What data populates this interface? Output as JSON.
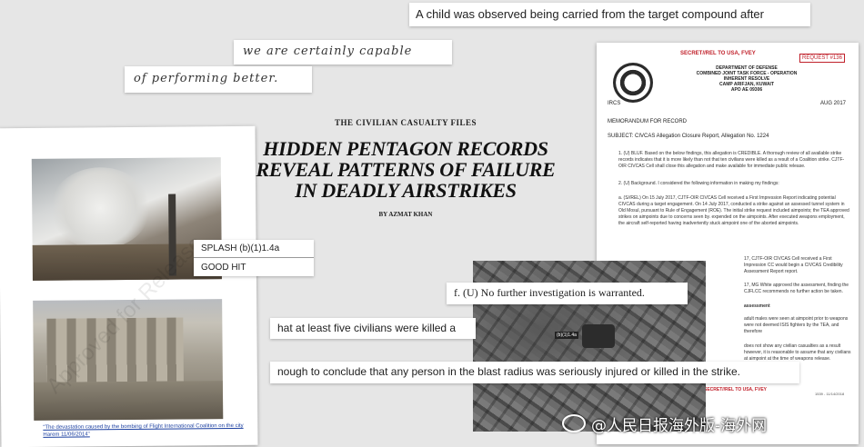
{
  "strips": {
    "top_right": "A child was observed being carried from the target compound after",
    "hand_1": "we are certainly capable",
    "hand_2": "of performing better.",
    "investigation": "f. (U) No further investigation is warranted.",
    "civilians": "hat at least five civilians were killed a",
    "blast": "nough to conclude that any person in the blast radius was seriously injured or killed in the strike."
  },
  "headline": {
    "kicker": "THE CIVILIAN CASUALTY FILES",
    "title_1": "HIDDEN PENTAGON RECORDS",
    "title_2": "REVEAL PATTERNS OF FAILURE",
    "title_3": "IN DEADLY AIRSTRIKES",
    "byline": "BY AZMAT KHAN"
  },
  "left_doc": {
    "label_1": "SPLASH (b)(1)1.4a",
    "label_2": "GOOD HIT",
    "caption": "\"The devastation caused by the bombing of Flight International Coalition on the city Harem 11/06/2014\""
  },
  "memo": {
    "classification": "SECRET//REL TO USA, FVEY",
    "request": "REQUEST #136",
    "dept_1": "DEPARTMENT OF DEFENSE",
    "dept_2": "COMBINED JOINT TASK FORCE - OPERATION INHERENT RESOLVE",
    "dept_3": "CAMP ARIFJAN, KUWAIT",
    "dept_4": "APO AE 09306",
    "ircs": "IRCS",
    "date": "AUG 2017",
    "memo_for": "MEMORANDUM FOR RECORD",
    "subject": "SUBJECT: CIVCAS Allegation Closure Report, Allegation No. 1224",
    "p1": "1. (U) BLUF. Based on the below findings, this allegation is CREDIBLE. A thorough review of all available strike records indicates that it is more likely than not that ten civilians were killed as a result of a Coalition strike. CJTF-OIR CIVCAS Cell shall close this allegation and make available for immediate public release.",
    "p2": "2. (U) Background. I considered the following information in making my findings:",
    "p3": "a. (S//REL) On 15 July 2017, CJTF-OIR CIVCAS Cell received a First Impression Report indicating potential CIVCAS during a target engagement. On 14 July 2017, conducted a strike against an assessed tunnel system in Old Mosul, pursuant to Rule of Engagement (ROE). The initial strike request included aimpoints; the TEA approved strikes on aimpoints due to concerns seen by. expended on the aimpoints. After executed weapons employment, the aircraft self-reported having inadvertently stuck aimpoint one of the aborted aimpoints.",
    "p4": "17, CJTF-OIR CIVCAS Cell received a First Impression CC would begin a CIVCAS Credibility Assessment Report report.",
    "p5": "17, MG White approved the assessment, finding the CJFLCC recommends no further action be taken.",
    "p6": "assessment",
    "p7": "adult males were seen at aimpoint prior to weapons were not deemed ISIS fighters by the TEA, and therefore",
    "p8": "does not show any civilian casualties as a result however, it is reasonable to assume that any civilians at aimpoint at the time of weapons release.",
    "footer_class": "SECRET//REL TO USA, FVEY",
    "footer_code": "1539 - 11/14/2018"
  },
  "aerial": {
    "label": "(b)(1)1.4a"
  },
  "watermark": {
    "left": "Approved for Release",
    "weibo": "@人民日报海外版-海外网"
  }
}
